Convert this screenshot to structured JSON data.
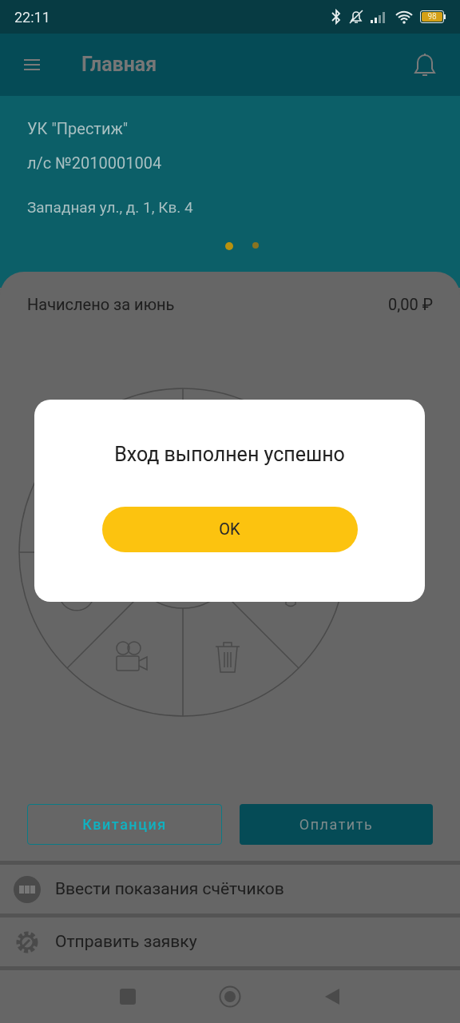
{
  "status_bar": {
    "time": "22:11",
    "battery": "98"
  },
  "toolbar": {
    "title": "Главная"
  },
  "account": {
    "company": "УК \"Престиж\"",
    "account_number": "л/с №2010001004",
    "address": "Западная ул., д. 1, Кв. 4"
  },
  "pages": [
    {
      "selected": true
    },
    {
      "selected": false
    }
  ],
  "charge": {
    "label": "Начислено за июнь",
    "amount": "0,00 ₽"
  },
  "buttons": [
    {
      "label": "Квитанция",
      "kind": "outline"
    },
    {
      "label": "Оплатить",
      "kind": "filled"
    }
  ],
  "menu": [
    {
      "label": "Ввести показания счётчиков",
      "kind": "meters"
    },
    {
      "label": "Отправить заявку",
      "kind": "request"
    }
  ],
  "dialog": {
    "message": "Вход выполнен успешно",
    "button": "OK"
  }
}
